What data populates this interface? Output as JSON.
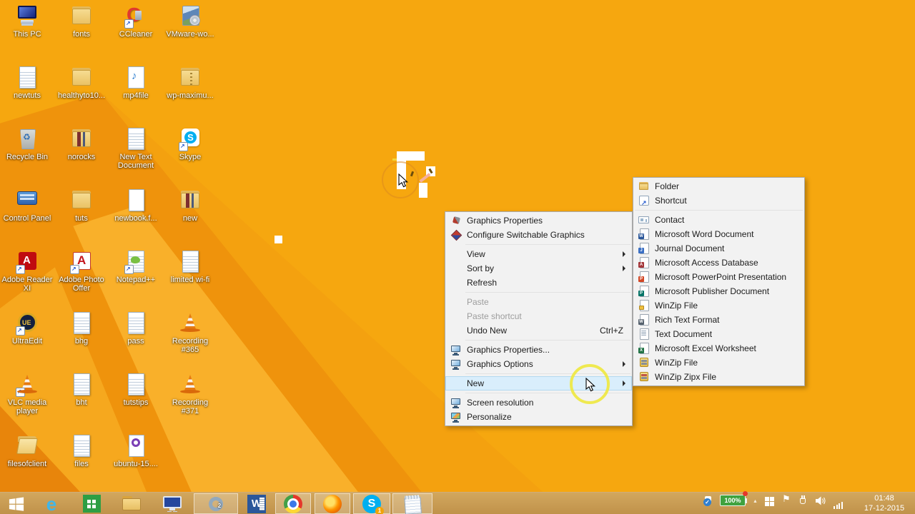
{
  "colors": {
    "wallpaper_orange": "#f6a70f",
    "wallpaper_dark_orange": "#ef930c",
    "wallpaper_beam": "#f9b02a",
    "taskbar_tan": "#c79a52",
    "menu_bg": "#f2f2f2",
    "menu_highlight": "#d9eefc",
    "highlight_ring_yellow": "#eee83e",
    "battery_green": "#3fa23f",
    "skype_blue": "#00aff0"
  },
  "desktop": {
    "icons": [
      {
        "label": "This PC",
        "icon": "computer-icon"
      },
      {
        "label": "fonts",
        "icon": "folder-icon"
      },
      {
        "label": "CCleaner",
        "icon": "ccleaner-icon"
      },
      {
        "label": "VMware-wo...",
        "icon": "software-box-icon"
      },
      {
        "label": "newtuts",
        "icon": "text-file-icon"
      },
      {
        "label": "healthyto10...",
        "icon": "folder-icon"
      },
      {
        "label": "mp4file",
        "icon": "media-file-icon"
      },
      {
        "label": "wp-maximu...",
        "icon": "zip-folder-icon"
      },
      {
        "label": "Recycle Bin",
        "icon": "recycle-bin-icon"
      },
      {
        "label": "norocks",
        "icon": "folder-with-files-icon"
      },
      {
        "label": "New Text Document",
        "icon": "text-file-icon"
      },
      {
        "label": "Skype",
        "icon": "skype-icon"
      },
      {
        "label": "Control Panel",
        "icon": "control-panel-icon"
      },
      {
        "label": "tuts",
        "icon": "folder-icon"
      },
      {
        "label": "newbook.f...",
        "icon": "file-icon"
      },
      {
        "label": "new",
        "icon": "folder-with-files-icon"
      },
      {
        "label": "Adobe Reader XI",
        "icon": "adobe-reader-icon"
      },
      {
        "label": "Adobe Photo Offer",
        "icon": "adobe-photo-icon"
      },
      {
        "label": "Notepad++",
        "icon": "notepad-plus-plus-icon"
      },
      {
        "label": "limited wi-fi",
        "icon": "text-file-icon"
      },
      {
        "label": "UltraEdit",
        "icon": "ultraedit-icon"
      },
      {
        "label": "bhg",
        "icon": "text-file-icon"
      },
      {
        "label": "pass",
        "icon": "text-file-icon"
      },
      {
        "label": "Recording #365",
        "icon": "vlc-cone-icon"
      },
      {
        "label": "VLC media player",
        "icon": "vlc-cone-icon"
      },
      {
        "label": "bht",
        "icon": "text-file-icon"
      },
      {
        "label": "tutstips",
        "icon": "text-file-icon"
      },
      {
        "label": "Recording #371",
        "icon": "vlc-cone-icon"
      },
      {
        "label": "filesofclient",
        "icon": "open-folder-icon"
      },
      {
        "label": "files",
        "icon": "text-file-icon"
      },
      {
        "label": "ubuntu-15....",
        "icon": "torrent-file-icon"
      }
    ]
  },
  "context_menu": {
    "items": [
      {
        "label": "Graphics Properties",
        "icon": "catalyst-icon"
      },
      {
        "label": "Configure Switchable Graphics",
        "icon": "switchable-graphics-icon"
      },
      {
        "label": "View",
        "has_submenu": true
      },
      {
        "label": "Sort by",
        "has_submenu": true
      },
      {
        "label": "Refresh"
      },
      {
        "label": "Paste",
        "disabled": true
      },
      {
        "label": "Paste shortcut",
        "disabled": true
      },
      {
        "label": "Undo New",
        "shortcut": "Ctrl+Z"
      },
      {
        "label": "Graphics Properties...",
        "icon": "graphics-monitor-icon"
      },
      {
        "label": "Graphics Options",
        "icon": "graphics-monitor-icon",
        "has_submenu": true
      },
      {
        "label": "New",
        "has_submenu": true,
        "highlighted": true
      },
      {
        "label": "Screen resolution",
        "icon": "screen-resolution-icon"
      },
      {
        "label": "Personalize",
        "icon": "personalize-icon"
      }
    ]
  },
  "new_submenu": {
    "items": [
      {
        "label": "Folder",
        "icon": "folder-icon"
      },
      {
        "label": "Shortcut",
        "icon": "shortcut-icon"
      },
      {
        "label": "Contact",
        "icon": "contact-card-icon"
      },
      {
        "label": "Microsoft Word Document",
        "icon": "word-doc-icon"
      },
      {
        "label": "Journal Document",
        "icon": "journal-doc-icon"
      },
      {
        "label": "Microsoft Access Database",
        "icon": "access-doc-icon"
      },
      {
        "label": "Microsoft PowerPoint Presentation",
        "icon": "powerpoint-doc-icon"
      },
      {
        "label": "Microsoft Publisher Document",
        "icon": "publisher-doc-icon"
      },
      {
        "label": "WinZip File",
        "icon": "winzip-doc-icon"
      },
      {
        "label": "Rich Text Format",
        "icon": "rtf-doc-icon"
      },
      {
        "label": "Text Document",
        "icon": "text-doc-icon"
      },
      {
        "label": "Microsoft Excel Worksheet",
        "icon": "excel-doc-icon"
      },
      {
        "label": "WinZip File",
        "icon": "winzip-yellow-icon"
      },
      {
        "label": "WinZip Zipx File",
        "icon": "winzip-zipx-icon"
      }
    ]
  },
  "taskbar": {
    "start": {
      "icon": "windows-start-icon"
    },
    "apps": [
      {
        "name": "internet-explorer",
        "icon": "internet-explorer-icon"
      },
      {
        "name": "windows-store",
        "icon": "windows-store-icon"
      },
      {
        "name": "file-explorer",
        "icon": "file-explorer-icon"
      },
      {
        "name": "lenovo-settings",
        "icon": "lenovo-display-icon"
      },
      {
        "name": "screen-recorder",
        "icon": "recorder-ring-icon",
        "badge": "2",
        "open": true
      },
      {
        "name": "word",
        "icon": "word-icon"
      },
      {
        "name": "chrome",
        "icon": "chrome-icon",
        "open": true
      },
      {
        "name": "firefox",
        "icon": "firefox-icon",
        "open": true
      },
      {
        "name": "skype",
        "icon": "skype-icon",
        "badge": "1",
        "open": true
      },
      {
        "name": "notepad",
        "icon": "notepad-icon",
        "open": true
      }
    ],
    "tray": {
      "icons": [
        "update-check-icon",
        "battery-indicator",
        "tray-expand-caret-icon",
        "action-center-icon",
        "flag-icon",
        "power-plug-icon",
        "speaker-icon",
        "network-signal-icon"
      ],
      "battery_percent": "100%"
    },
    "clock": {
      "time": "01:48",
      "date": "17-12-2015"
    }
  }
}
